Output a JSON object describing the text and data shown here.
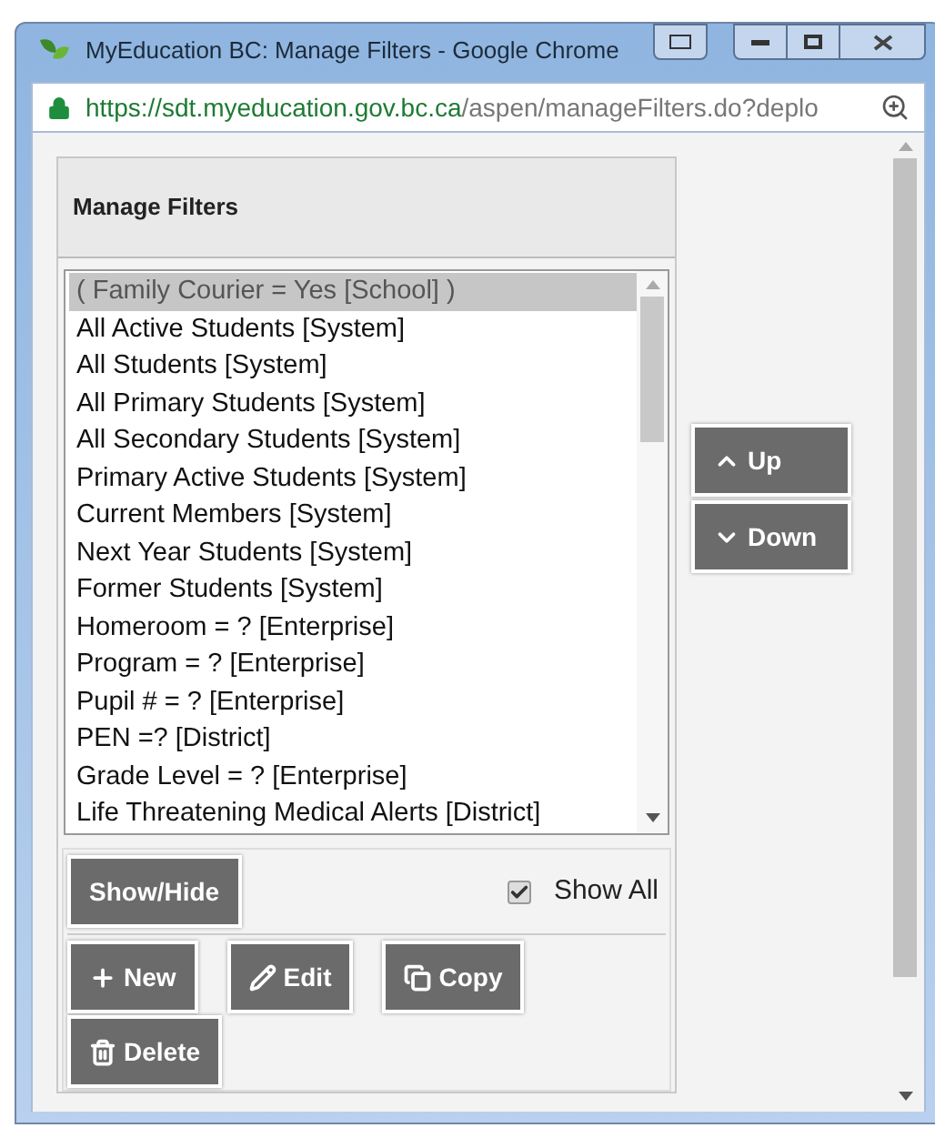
{
  "window": {
    "title": "MyEducation BC: Manage Filters - Google Chrome",
    "url_host": "https://sdt.myeducation.gov.bc.ca",
    "url_path": "/aspen/manageFilters.do?deplo"
  },
  "panel": {
    "title": "Manage Filters"
  },
  "filters": [
    {
      "label": "( Family Courier = Yes [School] )",
      "selected": true
    },
    {
      "label": "All Active Students [System]",
      "selected": false
    },
    {
      "label": "All Students [System]",
      "selected": false
    },
    {
      "label": "All Primary Students [System]",
      "selected": false
    },
    {
      "label": "All Secondary Students [System]",
      "selected": false
    },
    {
      "label": "Primary Active Students [System]",
      "selected": false
    },
    {
      "label": "Current Members [System]",
      "selected": false
    },
    {
      "label": "Next Year Students [System]",
      "selected": false
    },
    {
      "label": "Former Students [System]",
      "selected": false
    },
    {
      "label": "Homeroom = ? [Enterprise]",
      "selected": false
    },
    {
      "label": "Program = ? [Enterprise]",
      "selected": false
    },
    {
      "label": "Pupil # = ? [Enterprise]",
      "selected": false
    },
    {
      "label": "PEN =? [District]",
      "selected": false
    },
    {
      "label": "Grade Level = ? [Enterprise]",
      "selected": false
    },
    {
      "label": "Life Threatening Medical Alerts [District]",
      "selected": false
    }
  ],
  "move_buttons": [
    {
      "kind": "up",
      "label": "Up"
    },
    {
      "kind": "down",
      "label": "Down"
    }
  ],
  "show_hide_button": "Show/Hide",
  "show_all": {
    "label": "Show All",
    "checked": true
  },
  "action_buttons": [
    {
      "kind": "new",
      "label": "New"
    },
    {
      "kind": "edit",
      "label": "Edit"
    },
    {
      "kind": "copy",
      "label": "Copy"
    },
    {
      "kind": "delete",
      "label": "Delete"
    }
  ]
}
